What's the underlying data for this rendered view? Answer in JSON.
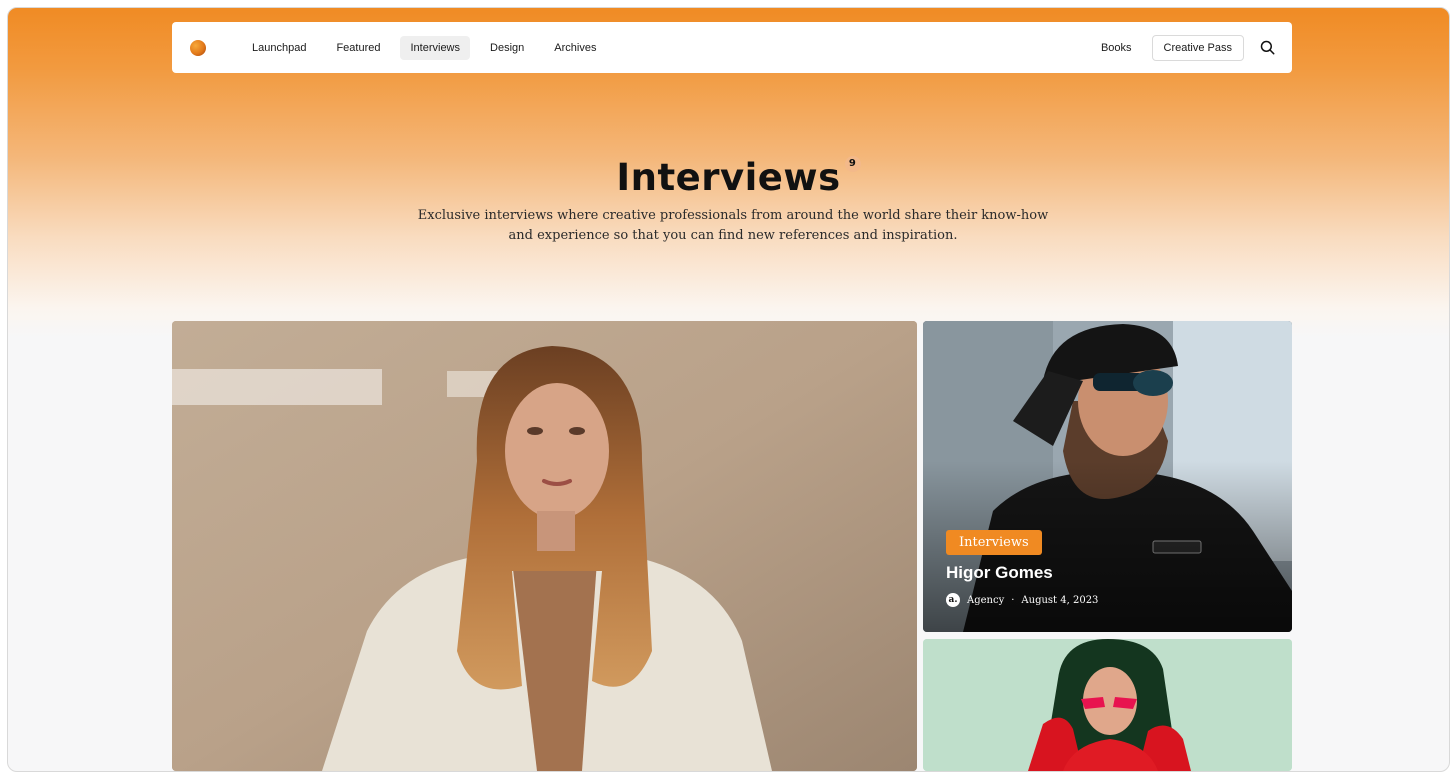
{
  "nav": {
    "links": [
      {
        "label": "Launchpad",
        "active": false
      },
      {
        "label": "Featured",
        "active": false
      },
      {
        "label": "Interviews",
        "active": true
      },
      {
        "label": "Design",
        "active": false
      },
      {
        "label": "Archives",
        "active": false
      }
    ],
    "books": "Books",
    "creative_pass": "Creative Pass",
    "search_icon": "search-icon"
  },
  "hero": {
    "title": "Interviews",
    "count": "9",
    "subtitle": "Exclusive interviews where creative professionals from around the world share their know-how and experience so that you can find new references and inspiration."
  },
  "posts": [
    {
      "category": "",
      "title": "",
      "image": "woman-portrait"
    },
    {
      "category": "Interviews",
      "title": "Higor Gomes",
      "author": "Agency",
      "author_avatar": "a.",
      "date": "August 4, 2023",
      "image": "bearded-man-sunglasses"
    },
    {
      "category": "",
      "title": "",
      "image": "woman-red-sunglasses"
    }
  ],
  "colors": {
    "accent": "#f08a22",
    "hero_gradient_top": "#f08b24",
    "page_bg": "#f7f7f8"
  }
}
